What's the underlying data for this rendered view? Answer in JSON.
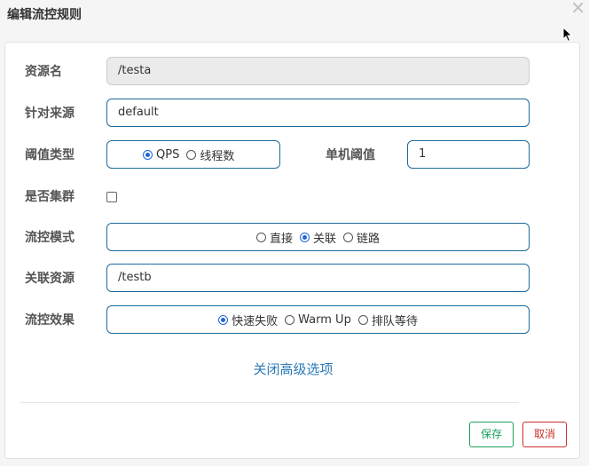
{
  "dialog": {
    "title": "编辑流控规则",
    "close_symbol": "×"
  },
  "form": {
    "resource": {
      "label": "资源名",
      "value": "/testa"
    },
    "source": {
      "label": "针对来源",
      "value": "default"
    },
    "threshold_type": {
      "label": "阈值类型",
      "options": [
        "QPS",
        "线程数"
      ],
      "selected": "QPS"
    },
    "single_threshold": {
      "label": "单机阈值",
      "value": "1"
    },
    "cluster": {
      "label": "是否集群",
      "checked": false
    },
    "control_mode": {
      "label": "流控模式",
      "options": [
        "直接",
        "关联",
        "链路"
      ],
      "selected": "关联"
    },
    "related_resource": {
      "label": "关联资源",
      "value": "/testb"
    },
    "control_effect": {
      "label": "流控效果",
      "options": [
        "快速失败",
        "Warm Up",
        "排队等待"
      ],
      "selected": "快速失败"
    }
  },
  "advanced_link": "关闭高级选项",
  "buttons": {
    "save": "保存",
    "cancel": "取消"
  }
}
